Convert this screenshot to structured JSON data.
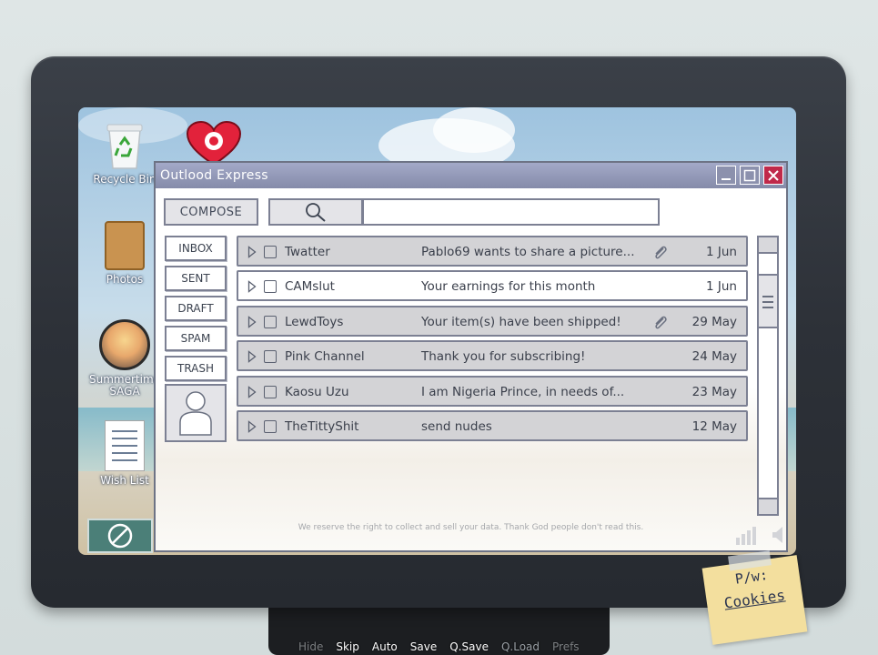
{
  "desktop": {
    "icons": [
      {
        "label": "Recycle Bin"
      },
      {
        "label": "Photos"
      },
      {
        "label": "Summertime SAGA"
      },
      {
        "label": "Wish List"
      }
    ]
  },
  "window": {
    "title": "Outlood Express",
    "controls": {
      "minimize": "_",
      "maximize": "□",
      "close": "✕"
    }
  },
  "toolbar": {
    "compose_label": "COMPOSE",
    "search_placeholder": ""
  },
  "folders": {
    "inbox": "INBOX",
    "sent": "SENT",
    "draft": "DRAFT",
    "spam": "SPAM",
    "trash": "TRASH"
  },
  "emails": [
    {
      "sender": "Twatter",
      "subject": "Pablo69 wants to share a picture...",
      "attachment": true,
      "date": "1 Jun"
    },
    {
      "sender": "CAMslut",
      "subject": "Your earnings for this month",
      "attachment": false,
      "date": "1 Jun",
      "selected": true
    },
    {
      "sender": "LewdToys",
      "subject": "Your item(s) have been shipped!",
      "attachment": true,
      "date": "29 May"
    },
    {
      "sender": "Pink Channel",
      "subject": "Thank you for subscribing!",
      "attachment": false,
      "date": "24 May"
    },
    {
      "sender": "Kaosu Uzu",
      "subject": "I am Nigeria Prince, in needs of...",
      "attachment": false,
      "date": "23 May"
    },
    {
      "sender": "TheTittyShit",
      "subject": "send nudes",
      "attachment": false,
      "date": "12 May"
    }
  ],
  "footer": {
    "disclaimer": "We reserve the right to collect and sell your data. Thank God people don't read this."
  },
  "sticky_note": {
    "line1": "P/w:",
    "line2": "Cookies"
  },
  "quick_menu": {
    "hide": "Hide",
    "skip": "Skip",
    "auto": "Auto",
    "save": "Save",
    "qsave": "Q.Save",
    "qload": "Q.Load",
    "prefs": "Prefs"
  },
  "colors": {
    "titlebar": "#858ba9",
    "close_button": "#c0294a",
    "row_bg": "#d3d3d6",
    "border": "#7c8093",
    "sticky": "#f3df9e"
  }
}
